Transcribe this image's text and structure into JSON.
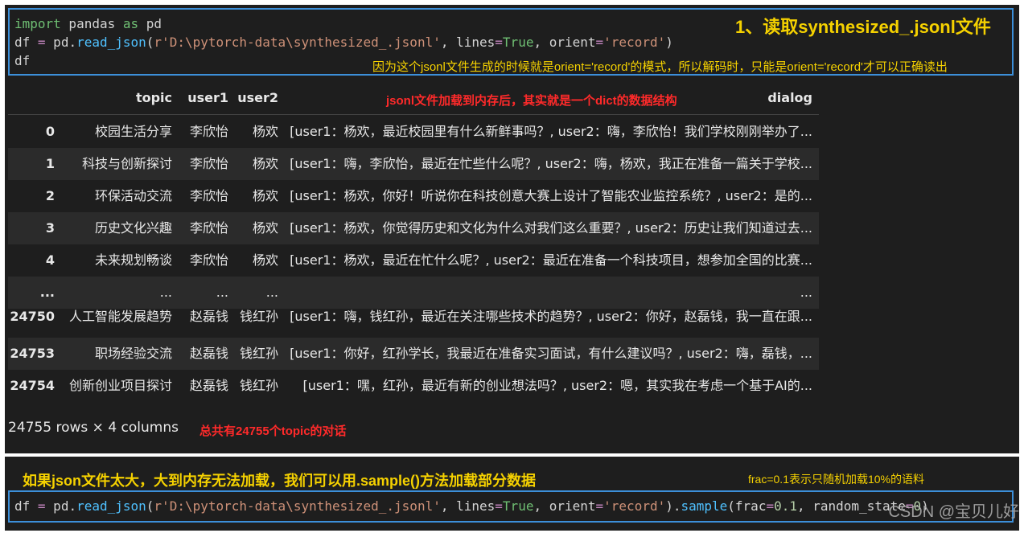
{
  "code1": {
    "line1": [
      "import",
      " pandas ",
      "as",
      " pd"
    ],
    "line2_parts": [
      "df ",
      "=",
      " pd.",
      "read_json",
      "(",
      "r'D:\\pytorch-data\\synthesized_.jsonl'",
      ", lines",
      "=",
      "True",
      ", orient",
      "=",
      "'record'",
      ")"
    ],
    "line3": "df"
  },
  "annotations": {
    "title1": "1、读取synthesized_.jsonl文件",
    "note_orient": "因为这个jsonl文件生成的时候就是orient='record'的模式，所以解码时，只能是orient='record'才可以正确读出",
    "note_dict": "jsonl文件加载到内存后，其实就是一个dict的数据结构",
    "note_total": "总共有24755个topic的对话",
    "title2": "如果json文件太大，大到内存无法加载，我们可以用.sample()方法加载部分数据",
    "note_frac": "frac=0.1表示只随机加载10%的语料"
  },
  "table": {
    "headers": {
      "topic": "topic",
      "user1": "user1",
      "user2": "user2",
      "dialog": "dialog"
    },
    "rows": [
      {
        "idx": "0",
        "topic": "校园生活分享",
        "user1": "李欣怡",
        "user2": "杨欢",
        "dialog": "[user1：杨欢，最近校园里有什么新鲜事吗？, user2：嗨，李欣怡！我们学校刚刚举办了..."
      },
      {
        "idx": "1",
        "topic": "科技与创新探讨",
        "user1": "李欣怡",
        "user2": "杨欢",
        "dialog": "[user1：嗨，李欣怡，最近在忙些什么呢？, user2：嗨，杨欢，我正在准备一篇关于学校..."
      },
      {
        "idx": "2",
        "topic": "环保活动交流",
        "user1": "李欣怡",
        "user2": "杨欢",
        "dialog": "[user1：杨欢，你好！听说你在科技创意大赛上设计了智能农业监控系统？, user2：是的..."
      },
      {
        "idx": "3",
        "topic": "历史文化兴趣",
        "user1": "李欣怡",
        "user2": "杨欢",
        "dialog": "[user1：杨欢，你觉得历史和文化为什么对我们这么重要？, user2：历史让我们知道过去..."
      },
      {
        "idx": "4",
        "topic": "未来规划畅谈",
        "user1": "李欣怡",
        "user2": "杨欢",
        "dialog": "[user1：杨欢，最近在忙什么呢？, user2：最近在准备一个科技项目，想参加全国的比赛..."
      },
      {
        "idx": "...",
        "topic": "...",
        "user1": "...",
        "user2": "...",
        "dialog": "..."
      },
      {
        "idx": "24750",
        "topic": "人工智能发展趋势",
        "user1": "赵磊钱",
        "user2": "钱红孙",
        "dialog": "[user1：嗨，钱红孙，最近在关注哪些技术的趋势？, user2：你好，赵磊钱，我一直在跟..."
      },
      {
        "idx": "24753",
        "topic": "职场经验交流",
        "user1": "赵磊钱",
        "user2": "钱红孙",
        "dialog": "[user1：你好，红孙学长，我最近在准备实习面试，有什么建议吗？, user2：嗨，磊钱，..."
      },
      {
        "idx": "24754",
        "topic": "创新创业项目探讨",
        "user1": "赵磊钱",
        "user2": "钱红孙",
        "dialog": "[user1：嘿，红孙，最近有新的创业想法吗？, user2：嗯，其实我在考虑一个基于AI的..."
      }
    ],
    "footer": "24755 rows × 4 columns"
  },
  "code2": {
    "parts": [
      "df ",
      "=",
      " pd.",
      "read_json",
      "(",
      "r'D:\\pytorch-data\\synthesized_.jsonl'",
      ", lines",
      "=",
      "True",
      ", orient",
      "=",
      "'record'",
      ").",
      "sample",
      "(frac",
      "=",
      "0.1",
      ", random_state",
      "=",
      "0",
      ")"
    ]
  },
  "watermark": "CSDN @宝贝儿好"
}
